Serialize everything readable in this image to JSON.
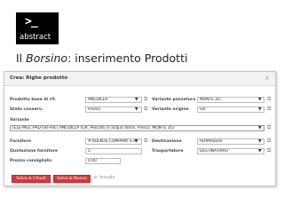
{
  "logo": {
    "cursor_text": ">_",
    "wordmark": "abstract"
  },
  "slide": {
    "title_prefix": "Il ",
    "title_emphasis": "Borsino",
    "title_suffix": ": inserimento Prodotti"
  },
  "dialog": {
    "title": "Crea: Righe prodotto",
    "close_glyph": "×",
    "fields": {
      "prodotto_base": {
        "label": "Prodotto base di rif.",
        "value": "ANGUILLA"
      },
      "variante_pezzatura": {
        "label": "Variante pezzatura",
        "value": "MONTE 2G"
      },
      "stato_conserv": {
        "label": "Stato conserv.",
        "value": "Fresco"
      },
      "variante_origine": {
        "label": "Variante origine",
        "value": "GR"
      },
      "variante": {
        "label": "Variante",
        "value": "[ELE-MGC-PAD-GR-FRE] ANGUILLA (GR, Pescato in acqua dolce, Fresco, MONTE 2G)"
      },
      "fornitore": {
        "label": "Fornitore",
        "value": "# KOLKOS COMPANY S.A."
      },
      "destinazione": {
        "label": "Destinazione",
        "value": "PLRM/Stock"
      },
      "quotazione_fornitore": {
        "label": "Quotazione fornitore",
        "value": "5"
      },
      "trasportatore": {
        "label": "Trasportatore",
        "value": "DESTINATARIO"
      },
      "prezzo_consigliato": {
        "label": "Prezzo consigliato",
        "value": "0.00"
      }
    },
    "buttons": {
      "save_close": "Salva & Chiudi",
      "save_new": "Salva & Nuovo",
      "or_text": "o",
      "cancel": "Annulla"
    }
  }
}
